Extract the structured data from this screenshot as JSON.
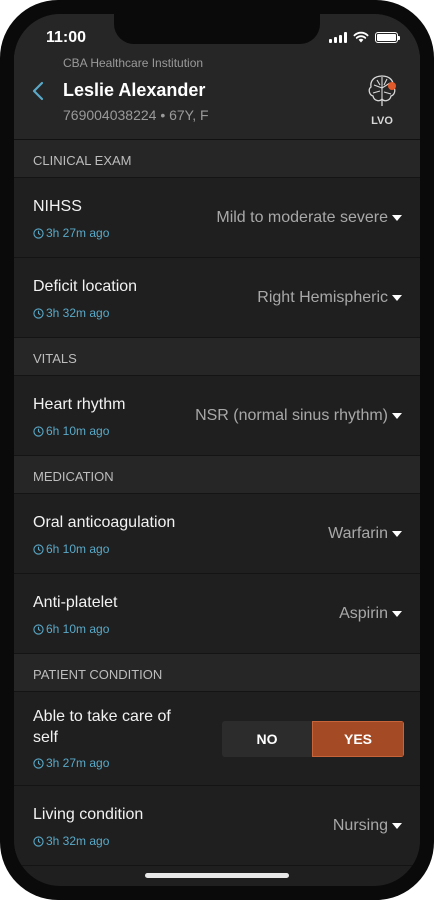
{
  "status": {
    "time": "11:00"
  },
  "header": {
    "institution": "CBA Healthcare Institution",
    "patient_name": "Leslie Alexander",
    "patient_meta": "769004038224 • 67Y, F",
    "lvo_label": "LVO",
    "lvo_dot_color": "#e05a2b"
  },
  "sections": {
    "clinical_exam": {
      "title": "CLINICAL EXAM",
      "nihss": {
        "label": "NIHSS",
        "time": "3h 27m ago",
        "value": "Mild to moderate severe"
      },
      "deficit": {
        "label": "Deficit location",
        "time": "3h 32m ago",
        "value": "Right Hemispheric"
      }
    },
    "vitals": {
      "title": "VITALS",
      "heart": {
        "label": "Heart rhythm",
        "time": "6h 10m ago",
        "value": "NSR (normal sinus rhythm)"
      }
    },
    "medication": {
      "title": "MEDICATION",
      "anticoag": {
        "label": "Oral anticoagulation",
        "time": "6h 10m ago",
        "value": "Warfarin"
      },
      "antiplatelet": {
        "label": "Anti-platelet",
        "time": "6h 10m ago",
        "value": "Aspirin"
      }
    },
    "patient_condition": {
      "title": "PATIENT CONDITION",
      "selfcare": {
        "label": "Able to take care of self",
        "time": "3h 27m ago",
        "no_label": "NO",
        "yes_label": "YES",
        "selected": "YES"
      },
      "living": {
        "label": "Living condition",
        "time": "3h 32m ago",
        "value": "Nursing"
      }
    }
  },
  "colors": {
    "accent": "#5aa9c8",
    "selected": "#a44a24"
  }
}
